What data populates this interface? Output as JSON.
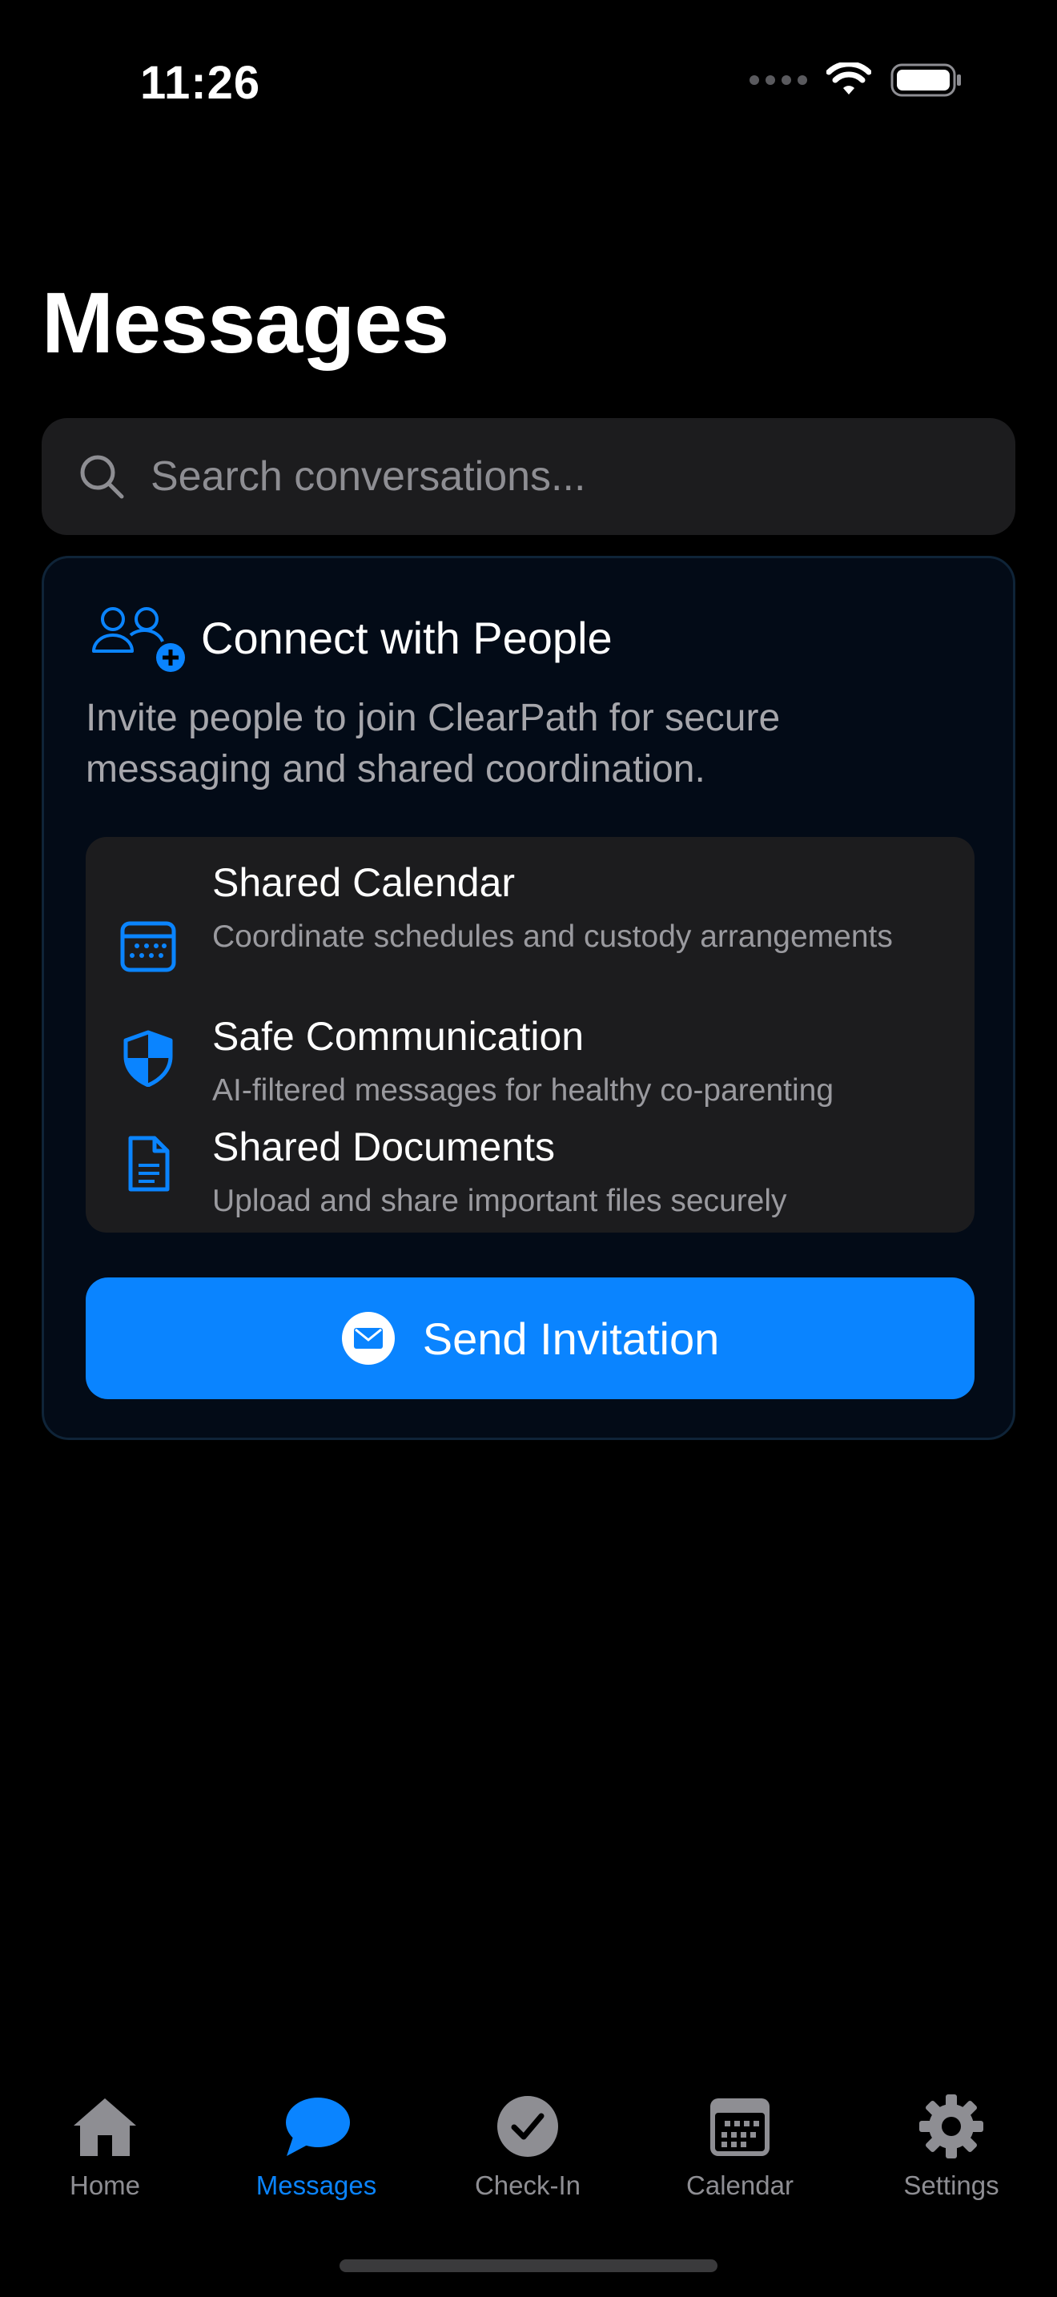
{
  "status_bar": {
    "time": "11:26"
  },
  "page": {
    "title": "Messages"
  },
  "search": {
    "placeholder": "Search conversations..."
  },
  "connect_card": {
    "title": "Connect with People",
    "description": "Invite people to join ClearPath for secure messaging and shared coordination.",
    "features": [
      {
        "icon": "calendar-icon",
        "title": "Shared Calendar",
        "subtitle": "Coordinate schedules and custody arrangements"
      },
      {
        "icon": "shield-icon",
        "title": "Safe Communication",
        "subtitle": "AI-filtered messages for healthy co-parenting"
      },
      {
        "icon": "document-icon",
        "title": "Shared Documents",
        "subtitle": "Upload and share important files securely"
      }
    ],
    "button_label": "Send Invitation"
  },
  "tabs": [
    {
      "icon": "house-icon",
      "label": "Home",
      "active": false
    },
    {
      "icon": "message-bubble-icon",
      "label": "Messages",
      "active": true
    },
    {
      "icon": "checkmark-circle-icon",
      "label": "Check-In",
      "active": false
    },
    {
      "icon": "calendar-icon",
      "label": "Calendar",
      "active": false
    },
    {
      "icon": "gear-icon",
      "label": "Settings",
      "active": false
    }
  ],
  "colors": {
    "accent": "#0a84ff",
    "inactive": "#8e8e93",
    "card_bg": "#1c1c1e"
  }
}
